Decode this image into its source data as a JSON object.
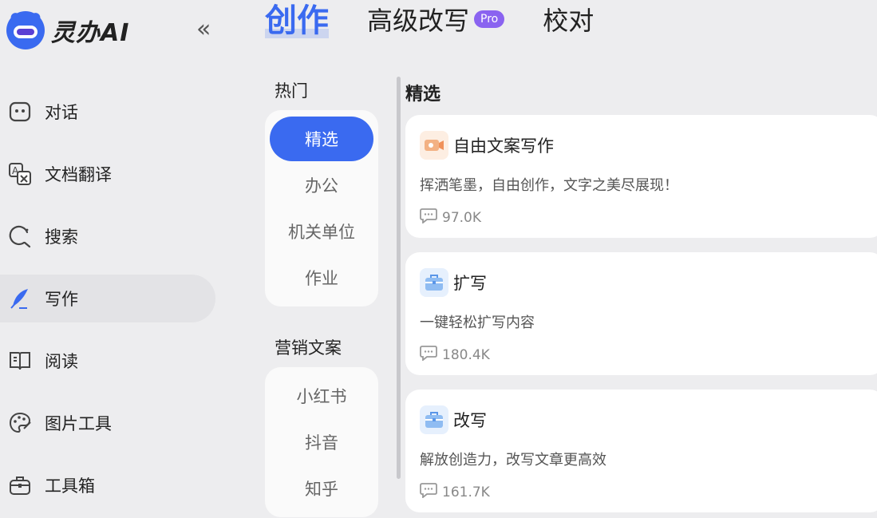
{
  "app": {
    "name": "灵办AI"
  },
  "sidebar": {
    "items": [
      {
        "label": "对话",
        "icon": "robot-face-icon"
      },
      {
        "label": "文档翻译",
        "icon": "translate-icon"
      },
      {
        "label": "搜索",
        "icon": "search-icon"
      },
      {
        "label": "写作",
        "icon": "quill-pen-icon",
        "active": true
      },
      {
        "label": "阅读",
        "icon": "open-book-icon"
      },
      {
        "label": "图片工具",
        "icon": "palette-icon"
      },
      {
        "label": "工具箱",
        "icon": "toolbox-icon"
      }
    ]
  },
  "tabs": [
    {
      "label": "创作",
      "active": true
    },
    {
      "label": "高级改写",
      "badge": "Pro"
    },
    {
      "label": "校对"
    }
  ],
  "categories": {
    "hot_heading": "热门",
    "hot_items": [
      "精选",
      "办公",
      "机关单位",
      "作业"
    ],
    "hot_active": "精选",
    "marketing_heading": "营销文案",
    "marketing_items": [
      "小红书",
      "抖音",
      "知乎"
    ]
  },
  "section": {
    "title": "精选"
  },
  "cards": [
    {
      "title": "自由文案写作",
      "desc": "挥洒笔墨，自由创作，文字之美尽展现！",
      "count": "97.0K",
      "icon": "camera-icon"
    },
    {
      "title": "扩写",
      "desc": "一键轻松扩写内容",
      "count": "180.4K",
      "icon": "briefcase-icon"
    },
    {
      "title": "改写",
      "desc": "解放创造力，改写文章更高效",
      "count": "161.7K",
      "icon": "briefcase-icon"
    }
  ],
  "colors": {
    "accent": "#3a6af0",
    "pro": "#8a63f0",
    "background": "#ededef"
  }
}
